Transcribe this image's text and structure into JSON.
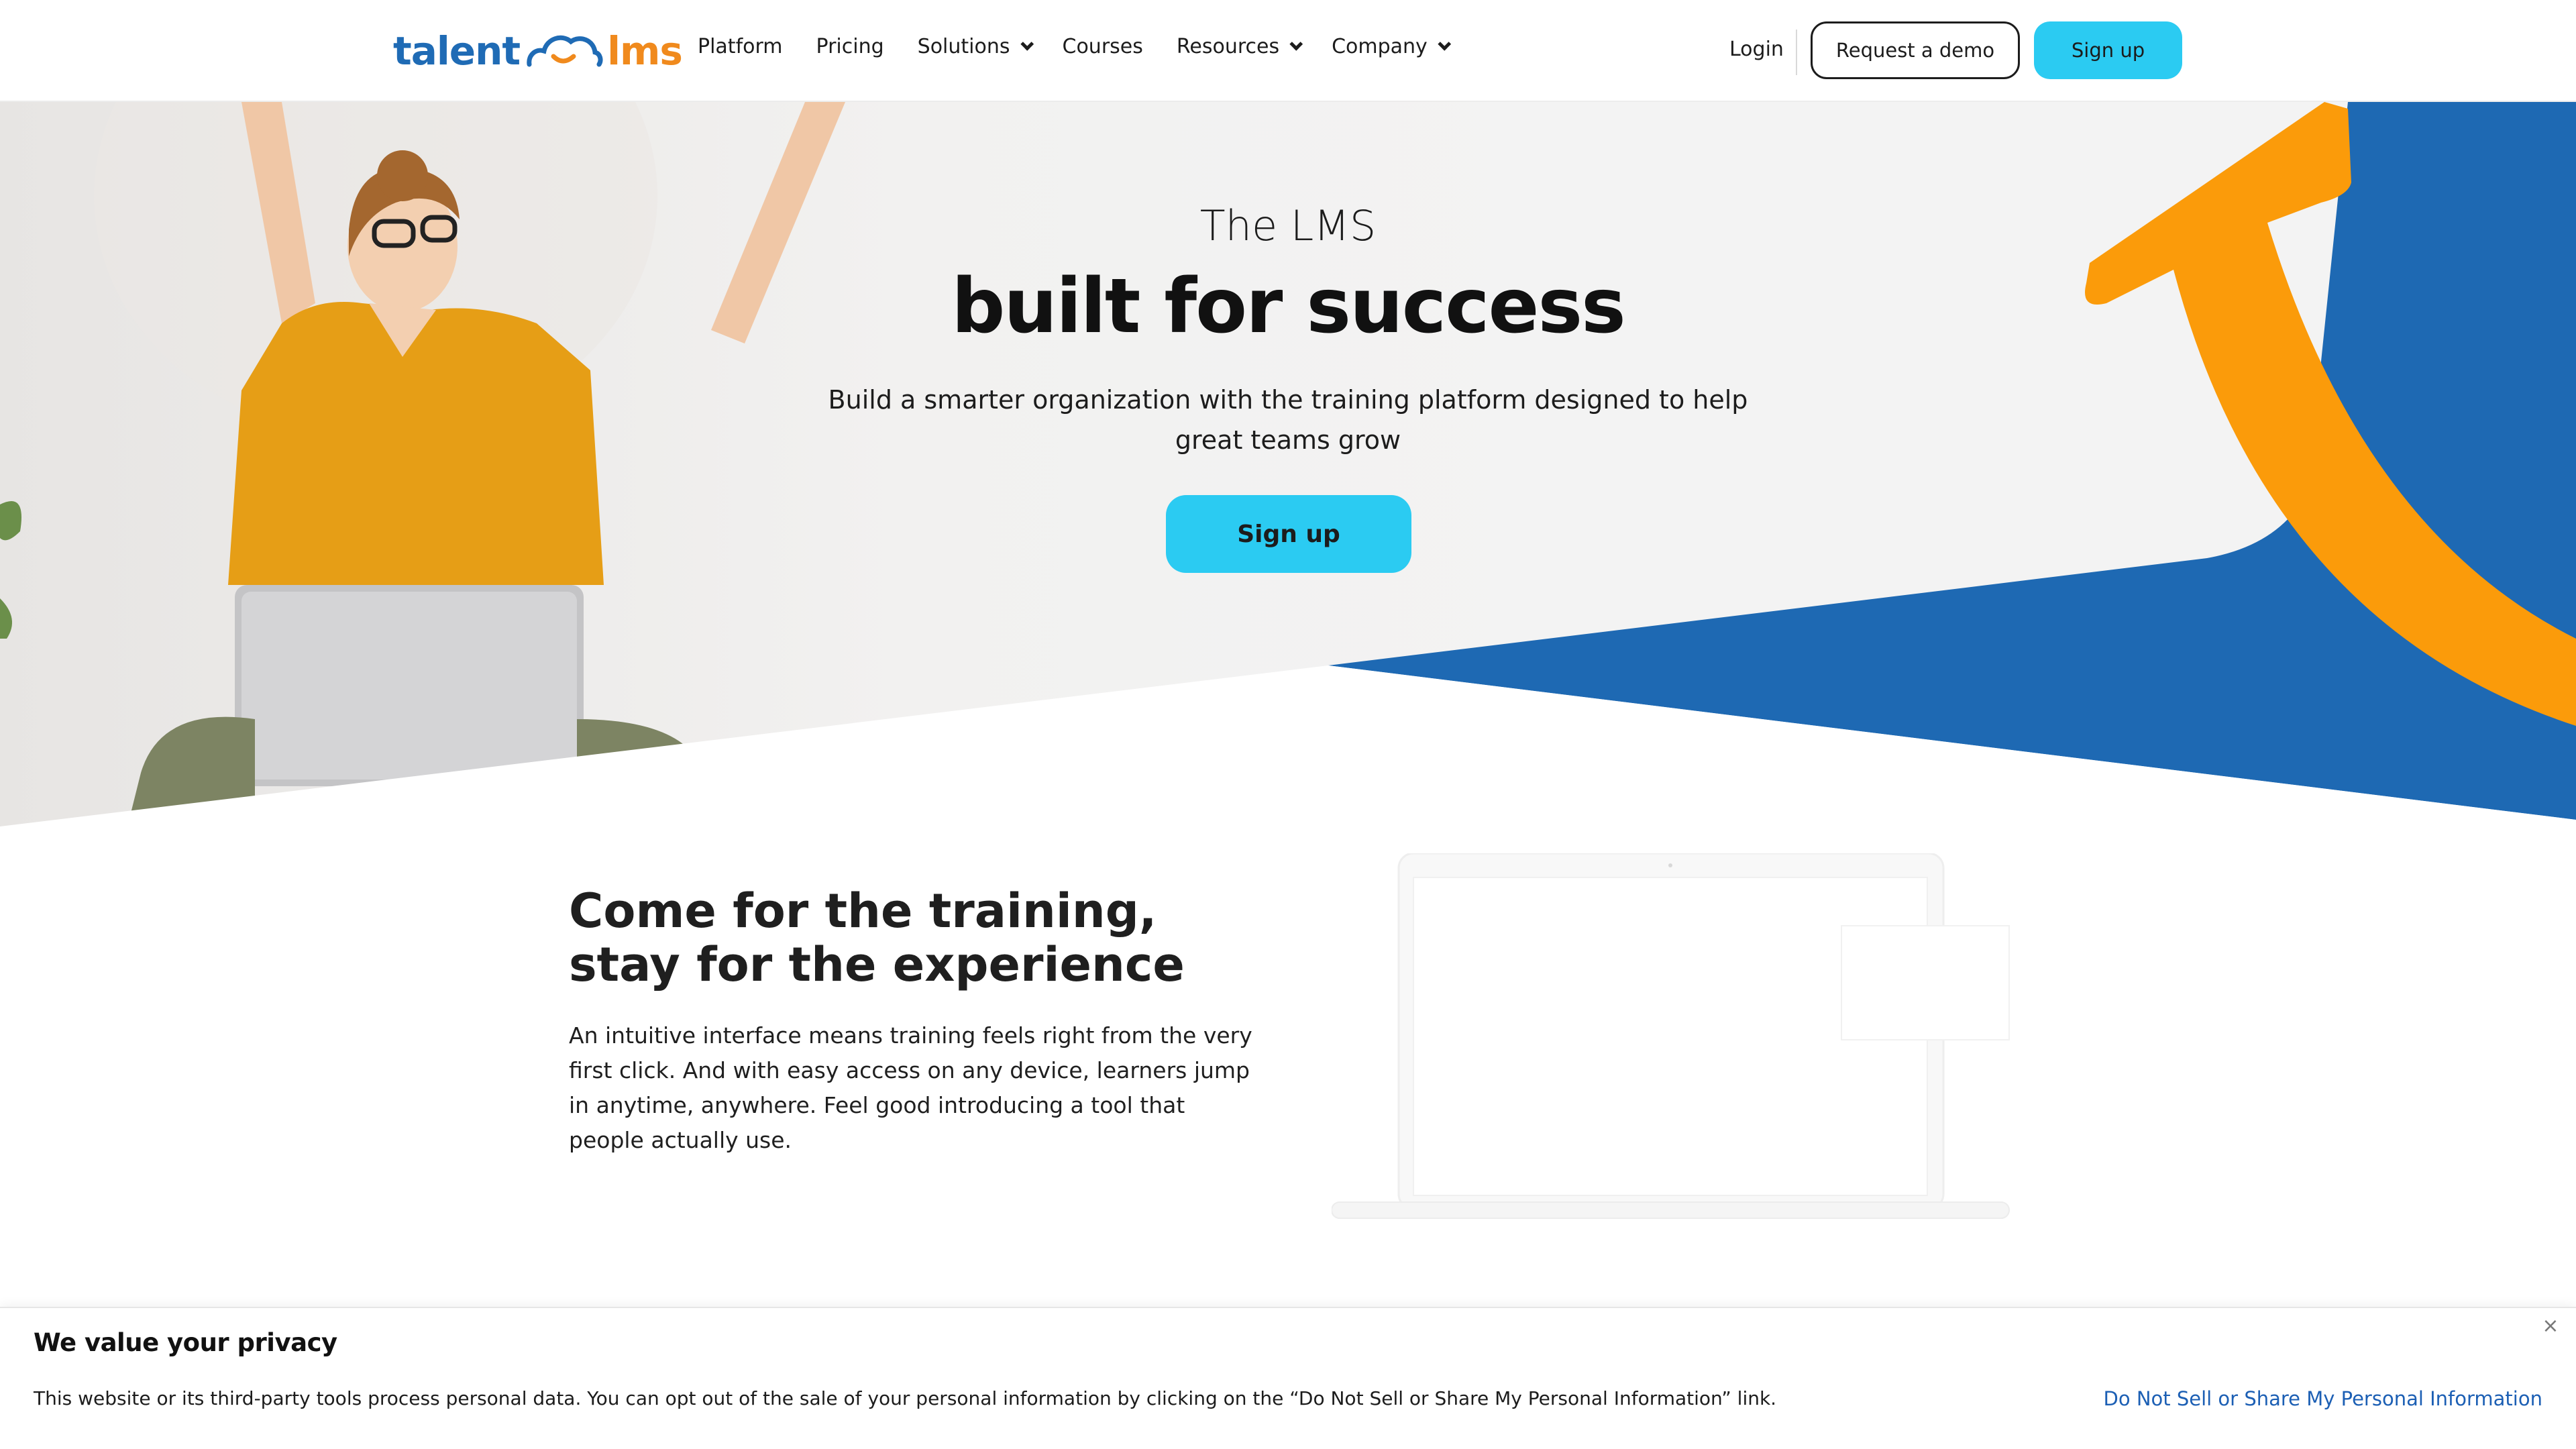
{
  "header": {
    "logo": {
      "part1": "talent",
      "part2": "lms"
    },
    "nav": [
      {
        "label": "Platform",
        "dropdown": false
      },
      {
        "label": "Pricing",
        "dropdown": false
      },
      {
        "label": "Solutions",
        "dropdown": true
      },
      {
        "label": "Courses",
        "dropdown": false
      },
      {
        "label": "Resources",
        "dropdown": true
      },
      {
        "label": "Company",
        "dropdown": true
      }
    ],
    "login": "Login",
    "request_demo": "Request a demo",
    "signup": "Sign up"
  },
  "hero": {
    "subtitle": "The LMS",
    "title": "built for success",
    "description": "Build a smarter organization with the training platform designed to help great teams grow",
    "cta": "Sign up"
  },
  "feature": {
    "title_line1": "Come for the training,",
    "title_line2": "stay for the experience",
    "text": "An intuitive interface means training feels right from the very first click. And with easy access on any device, learners jump in anytime, anywhere. Feel good introducing a tool that people actually use."
  },
  "cookie": {
    "title": "We value your privacy",
    "text": "This website or its third-party tools process personal data. You can opt out of the sale of your personal information by clicking on the “Do Not Sell or Share My Personal Information” link.",
    "link": "Do Not Sell or Share My Personal Information",
    "close": "×"
  },
  "colors": {
    "brand_blue": "#1f6bb5",
    "brand_orange": "#f08a1d",
    "accent_cyan": "#2bcbf2",
    "hero_blue": "#1e69b3",
    "hero_orange": "#fb9b0a",
    "link_blue": "#1c5fb4"
  }
}
